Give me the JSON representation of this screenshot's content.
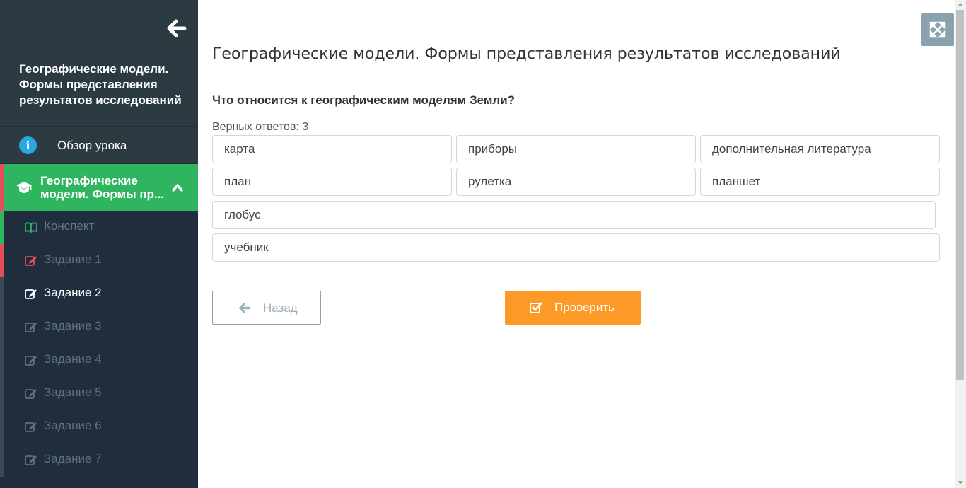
{
  "sidebar": {
    "course_title": "Географические модели. Формы представления результатов исследований",
    "overview_label": "Обзор урока",
    "lesson_line1": "Географические",
    "lesson_line2": "модели. Формы пр...",
    "items": [
      {
        "label": "Конспект"
      },
      {
        "label": "Задание 1"
      },
      {
        "label": "Задание 2"
      },
      {
        "label": "Задание 3"
      },
      {
        "label": "Задание 4"
      },
      {
        "label": "Задание 5"
      },
      {
        "label": "Задание 6"
      },
      {
        "label": "Задание 7"
      }
    ]
  },
  "main": {
    "title": "Географические модели. Формы представления результатов исследований",
    "question": "Что относится к географическим моделям Земли?",
    "correct_count": "Верных ответов: 3",
    "options": [
      "карта",
      "приборы",
      "дополнительная литература",
      "план",
      "рулетка",
      "планшет",
      "глобус",
      "учебник"
    ],
    "back_label": "Назад",
    "check_label": "Проверить"
  },
  "colors": {
    "sidebar_bg": "#1f2d3d",
    "active_lesson": "#2fb45f",
    "check_button": "#fd9a27",
    "error_strip": "#e44d5c"
  }
}
